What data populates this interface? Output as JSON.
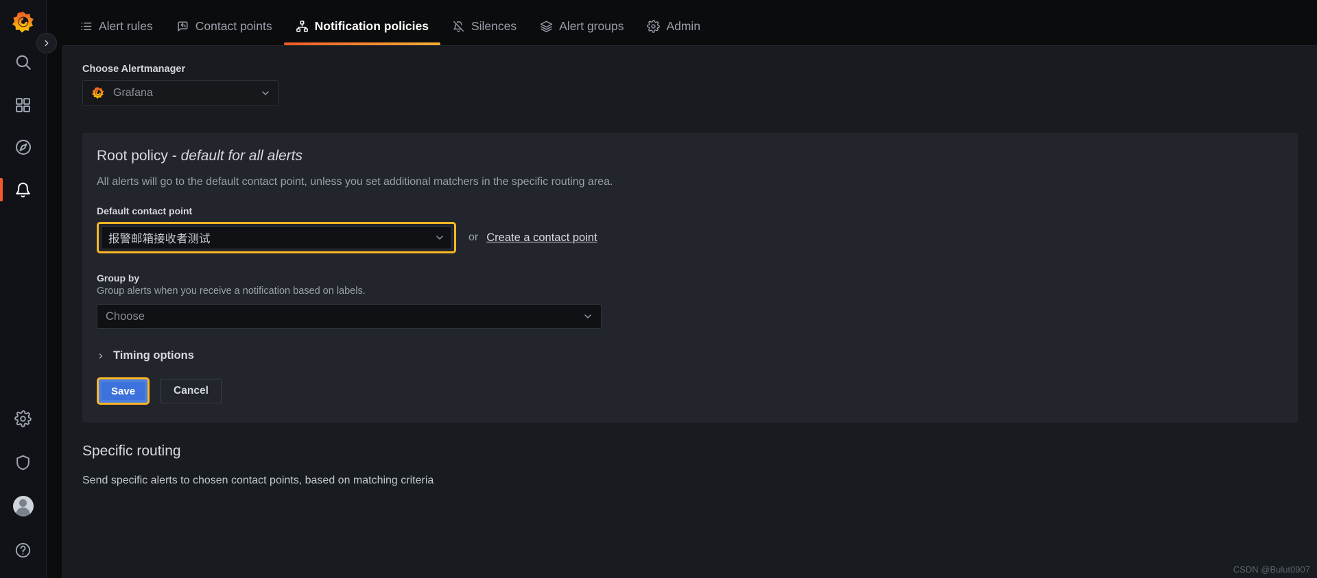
{
  "nav": {
    "logo": "grafana-logo",
    "expand_label": "expand-menu",
    "items": [
      {
        "icon": "search-icon",
        "label": "Search"
      },
      {
        "icon": "dashboards-icon",
        "label": "Dashboards"
      },
      {
        "icon": "explore-compass-icon",
        "label": "Explore"
      },
      {
        "icon": "alerting-bell-icon",
        "label": "Alerting",
        "active": true
      }
    ],
    "bottom_items": [
      {
        "icon": "gear-icon",
        "label": "Configuration"
      },
      {
        "icon": "shield-icon",
        "label": "Server Admin"
      },
      {
        "icon": "avatar-icon",
        "label": "Profile"
      },
      {
        "icon": "help-question-icon",
        "label": "Help"
      }
    ]
  },
  "tabs": [
    {
      "label": "Alert rules",
      "icon": "list-icon",
      "active": false
    },
    {
      "label": "Contact points",
      "icon": "comment-share-icon",
      "active": false
    },
    {
      "label": "Notification policies",
      "icon": "sitemap-icon",
      "active": true
    },
    {
      "label": "Silences",
      "icon": "bell-slash-icon",
      "active": false
    },
    {
      "label": "Alert groups",
      "icon": "layers-icon",
      "active": false
    },
    {
      "label": "Admin",
      "icon": "gear-icon",
      "active": false
    }
  ],
  "alertmanager": {
    "label": "Choose Alertmanager",
    "selected": "Grafana",
    "icon": "grafana-logo-icon",
    "chevron": "chevron-down-icon"
  },
  "root_policy": {
    "title_main": "Root policy",
    "title_sep": " - ",
    "title_italic": "default for all alerts",
    "description": "All alerts will go to the default contact point, unless you set additional matchers in the specific routing area.",
    "contact_point": {
      "label": "Default contact point",
      "value": "报警邮箱接收者测试",
      "chevron": "chevron-down-icon",
      "or_text": "or",
      "create_link": "Create a contact point",
      "highlight_color": "#ffb624"
    },
    "group_by": {
      "label": "Group by",
      "description": "Group alerts when you receive a notification based on labels.",
      "placeholder": "Choose",
      "chevron": "chevron-down-icon"
    },
    "timing_options": {
      "label": "Timing options",
      "chevron": "chevron-right-icon",
      "expanded": false
    },
    "buttons": {
      "save": "Save",
      "cancel": "Cancel",
      "save_color": "#3d71db",
      "save_focus_ring": "#ffb624"
    }
  },
  "specific_routing": {
    "title": "Specific routing",
    "description": "Send specific alerts to chosen contact points, based on matching criteria"
  },
  "watermark": "CSDN @Bulut0907"
}
